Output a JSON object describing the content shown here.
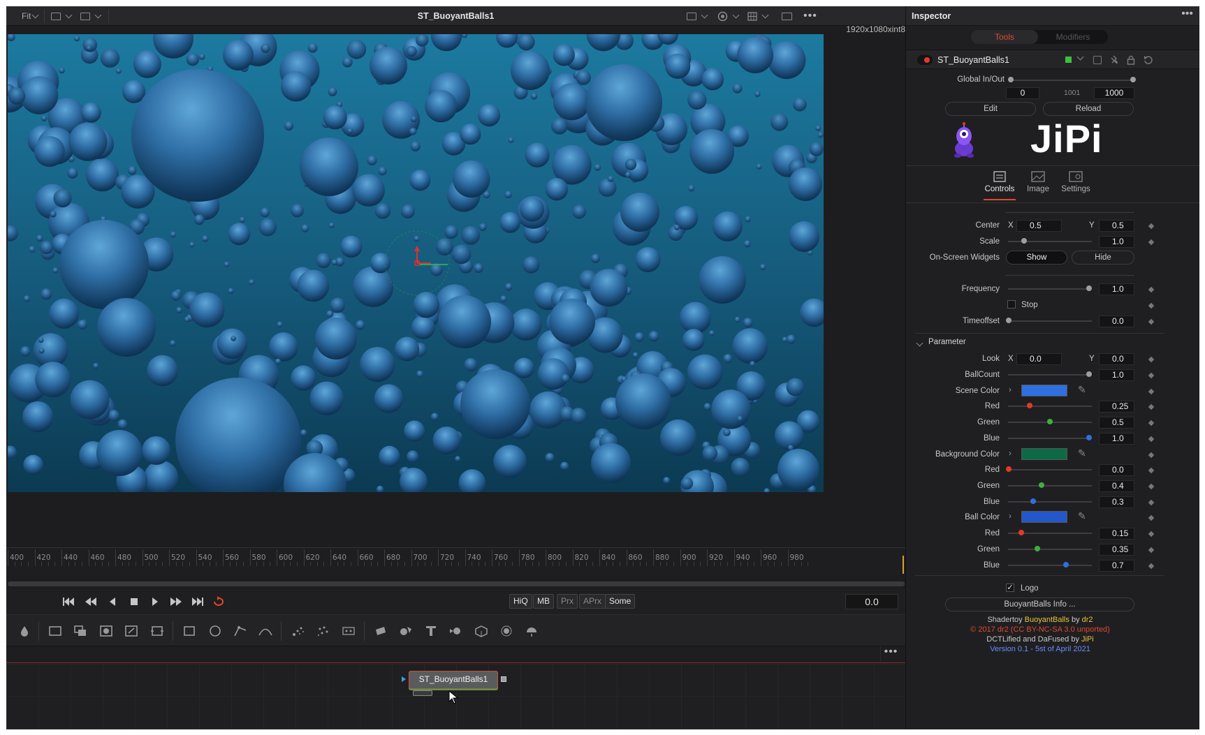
{
  "viewer": {
    "fit_label": "Fit",
    "title": "ST_BuoyantBalls1",
    "resolution": "1920x1080xint8",
    "ruler_ticks": [
      "400",
      "420",
      "440",
      "460",
      "480",
      "500",
      "520",
      "540",
      "560",
      "580",
      "600",
      "620",
      "640",
      "660",
      "680",
      "700",
      "720",
      "740",
      "760",
      "780",
      "800",
      "820",
      "840",
      "860",
      "880",
      "900",
      "920",
      "940",
      "960",
      "980"
    ],
    "current_time": "0.0",
    "quality_badges": [
      "HiQ",
      "MB",
      "Prx",
      "APrx",
      "Some"
    ]
  },
  "node_view": {
    "node_label": "ST_BuoyantBalls1",
    "menu": "•••"
  },
  "inspector": {
    "title": "Inspector",
    "menu": "•••",
    "tabs": {
      "tools": "Tools",
      "modifiers": "Modifiers"
    },
    "tool_name": "ST_BuoyantBalls1",
    "global_inout": {
      "label": "Global In/Out",
      "in": "0",
      "mid": "1001",
      "out": "1000"
    },
    "edit_button": "Edit",
    "reload_button": "Reload",
    "logo_text": "JiPi",
    "subtabs": [
      "Controls",
      "Image",
      "Settings"
    ],
    "controls": {
      "center": {
        "label": "Center",
        "x_label": "X",
        "x": "0.5",
        "y_label": "Y",
        "y": "0.5"
      },
      "scale": {
        "label": "Scale",
        "value": "1.0"
      },
      "widgets": {
        "label": "On-Screen Widgets",
        "show": "Show",
        "hide": "Hide"
      },
      "frequency": {
        "label": "Frequency",
        "value": "1.0"
      },
      "stop": {
        "label": "Stop"
      },
      "timeoffset": {
        "label": "Timeoffset",
        "value": "0.0"
      }
    },
    "parameter": {
      "section": "Parameter",
      "look": {
        "label": "Look",
        "x_label": "X",
        "x": "0.0",
        "y_label": "Y",
        "y": "0.0"
      },
      "ballcount": {
        "label": "BallCount",
        "value": "1.0"
      },
      "scene_color": {
        "label": "Scene Color",
        "swatch": "#2f6fe0",
        "red": "0.25",
        "green": "0.5",
        "blue": "1.0"
      },
      "background_color": {
        "label": "Background Color",
        "swatch": "#0d6a46",
        "red": "0.0",
        "green": "0.4",
        "blue": "0.3"
      },
      "ball_color": {
        "label": "Ball Color",
        "swatch": "#2457c9",
        "red": "0.15",
        "green": "0.35",
        "blue": "0.7"
      },
      "channel_labels": {
        "red": "Red",
        "green": "Green",
        "blue": "Blue"
      }
    },
    "logo_checkbox": "Logo",
    "info_button": "BuoyantBalls Info ...",
    "footer": {
      "line1_prefix": "Shadertoy ",
      "line1_name": "BuoyantBalls",
      "line1_by": " by ",
      "line1_author": "dr2",
      "line2": "© 2017 dr2 (CC BY-NC-SA 3.0 unported)",
      "line3_prefix": "DCTLified and DaFused by ",
      "line3_author": "JiPi",
      "line4": "Version 0.1 - 5st of April 2021"
    }
  },
  "colors": {
    "accent_red": "#e0482e",
    "link_yellow": "#e6c53a",
    "footer_red": "#e0482e",
    "footer_blue": "#6a8cff",
    "ocean_top": "#1a6f93",
    "ocean_bottom": "#0d3a52"
  }
}
